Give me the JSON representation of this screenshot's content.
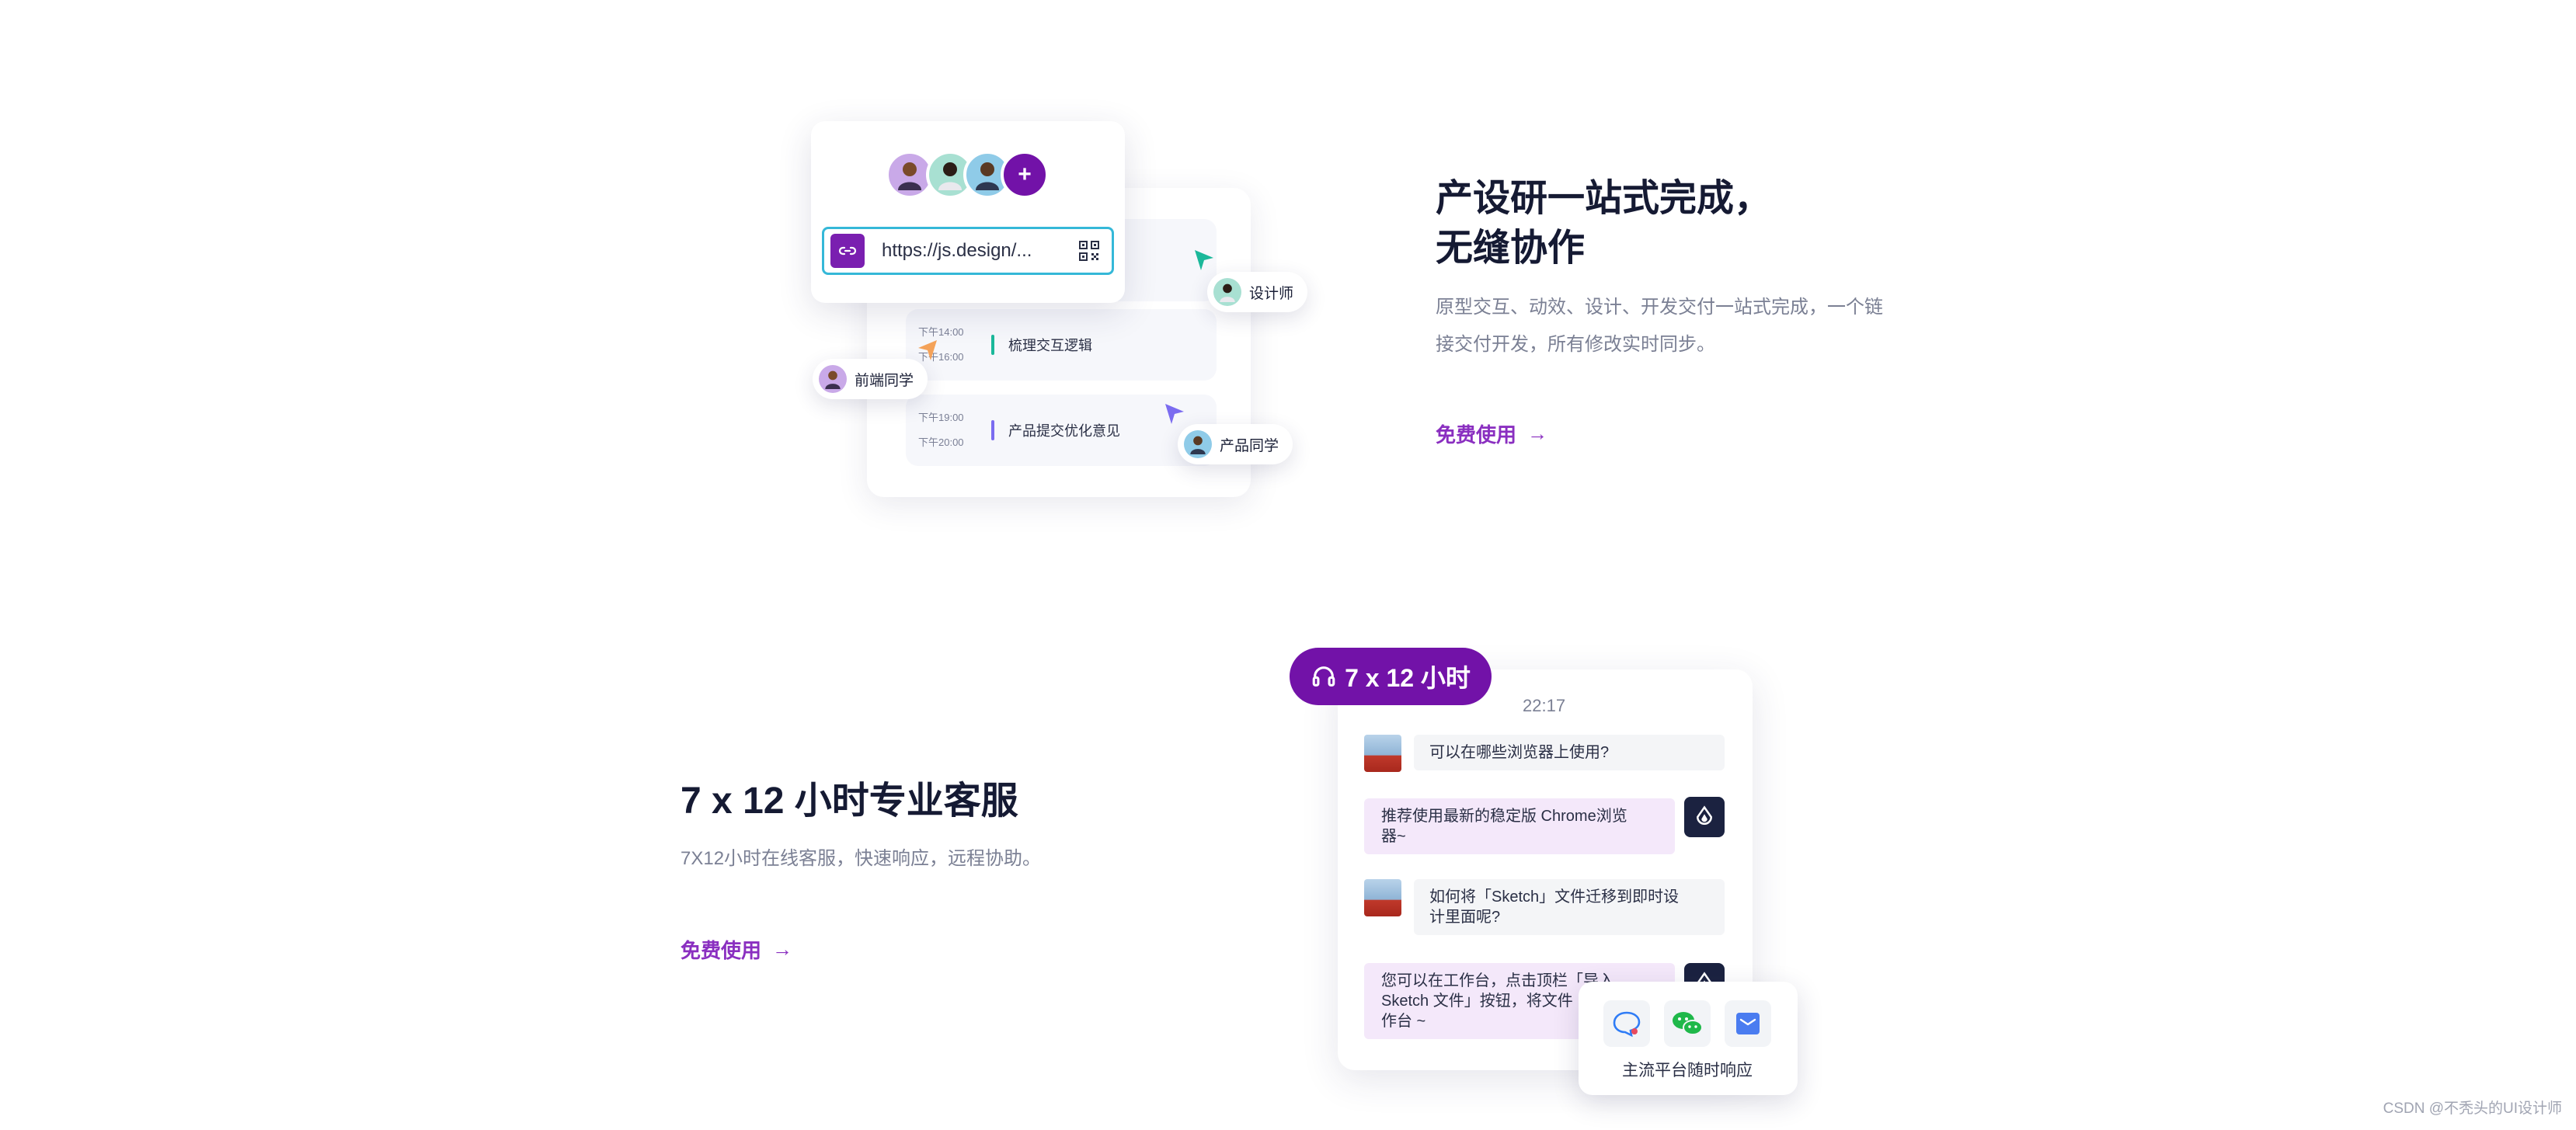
{
  "section1": {
    "title_line1": "产设研一站式完成，",
    "title_line2": "无缝协作",
    "description_line1": "原型交互、动效、设计、开发交付一站式完成，一个链",
    "description_line2": "接交付开发，所有修改实时同步。",
    "cta_label": "免费使用",
    "share": {
      "url": "https://js.design/...",
      "add_symbol": "+"
    },
    "tasks": [
      {
        "start": "",
        "end": "",
        "label": "",
        "color": "#ffffff"
      },
      {
        "start": "下午14:00",
        "end": "下午16:00",
        "label": "梳理交互逻辑",
        "color": "#1bb89a"
      },
      {
        "start": "下午19:00",
        "end": "下午20:00",
        "label": "产品提交优化意见",
        "color": "#7b6cf0"
      }
    ],
    "roles": {
      "designer": "设计师",
      "frontend": "前端同学",
      "product": "产品同学"
    }
  },
  "section2": {
    "title": "7 x 12 小时专业客服",
    "description": "7X12小时在线客服，快速响应，远程协助。",
    "cta_label": "免费使用",
    "pill_label": "7 x 12 小时",
    "chat_time": "22:17",
    "messages": {
      "q1": "可以在哪些浏览器上使用?",
      "a1_line1": "推荐使用最新的稳定版 Chrome浏览",
      "a1_line2": "器~",
      "q2_line1": "如何将「Sketch」文件迁移到即时设",
      "q2_line2": "计里面呢?",
      "a2_line1": "您可以在工作台，点击顶栏「导入",
      "a2_line2": "Sketch 文件」按钮，将文件",
      "a2_line3": "作台 ~"
    },
    "platforms_label": "主流平台随时响应"
  },
  "watermark": "CSDN @不秃头的UI设计师",
  "colors": {
    "accent": "#8a2fc0",
    "pill": "#7212a8",
    "heading": "#151a33",
    "muted": "#7b8094"
  }
}
